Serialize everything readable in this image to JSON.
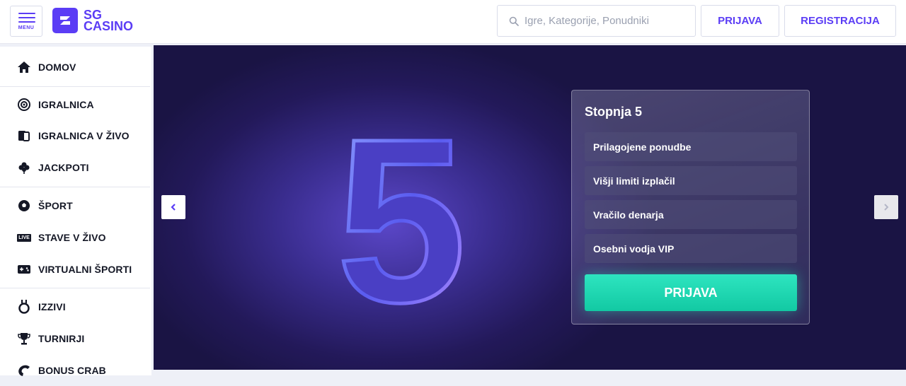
{
  "header": {
    "menu_label": "MENU",
    "logo_line1": "SG",
    "logo_line2": "CASINO",
    "search_placeholder": "Igre, Kategorije, Ponudniki",
    "login_label": "PRIJAVA",
    "register_label": "REGISTRACIJA"
  },
  "sidebar": {
    "items": [
      {
        "label": "DOMOV",
        "icon": "home-icon"
      },
      {
        "label": "IGRALNICA",
        "icon": "casino-chip-icon"
      },
      {
        "label": "IGRALNICA V ŽIVO",
        "icon": "live-cards-icon"
      },
      {
        "label": "JACKPOTI",
        "icon": "clover-icon"
      },
      {
        "label": "ŠPORT",
        "icon": "soccer-ball-icon"
      },
      {
        "label": "STAVE V ŽIVO",
        "icon": "live-badge-icon",
        "badge": "LIVE"
      },
      {
        "label": "VIRTUALNI ŠPORTI",
        "icon": "gamepad-icon"
      },
      {
        "label": "IZZIVI",
        "icon": "medal-icon"
      },
      {
        "label": "TURNIRJI",
        "icon": "trophy-icon"
      },
      {
        "label": "BONUS CRAB",
        "icon": "crab-claw-icon"
      }
    ]
  },
  "hero": {
    "big_number": "5",
    "card": {
      "title": "Stopnja 5",
      "perks": [
        "Prilagojene ponudbe",
        "Višji limiti izplačil",
        "Vračilo denarja",
        "Osebni vodja VIP"
      ],
      "cta_label": "PRIJAVA"
    }
  },
  "colors": {
    "brand": "#5b3df5",
    "cta": "#1fd6b0",
    "hero_bg": "#2a1f6e"
  }
}
